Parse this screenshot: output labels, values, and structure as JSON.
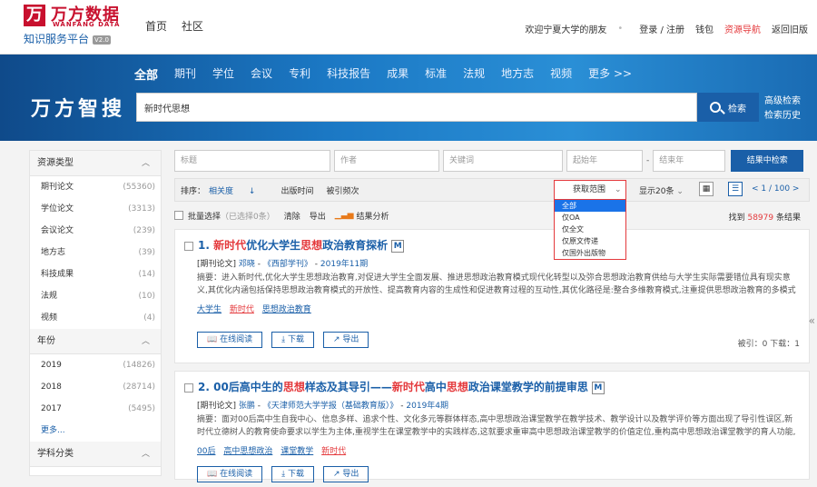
{
  "header": {
    "logo_cn": "万方数据",
    "logo_en": "WANFANG DATA",
    "subtitle": "知识服务平台",
    "version": "V2.0",
    "nav": [
      "首页",
      "社区"
    ],
    "welcome": "欢迎宁夏大学的朋友",
    "login": "登录 / 注册",
    "wallet": "钱包",
    "resource_nav": "资源导航",
    "old_version": "返回旧版"
  },
  "hero": {
    "brand": "万方智搜",
    "tabs": [
      "全部",
      "期刊",
      "学位",
      "会议",
      "专利",
      "科技报告",
      "成果",
      "标准",
      "法规",
      "地方志",
      "视频",
      "更多 >>"
    ],
    "search_value": "新时代思想",
    "search_button": "检索",
    "advanced": "高级检索",
    "history": "检索历史"
  },
  "sidebar": {
    "resource_type_title": "资源类型",
    "resource_types": [
      {
        "label": "期刊论文",
        "count": "(55360)"
      },
      {
        "label": "学位论文",
        "count": "(3313)"
      },
      {
        "label": "会议论文",
        "count": "(239)"
      },
      {
        "label": "地方志",
        "count": "(39)"
      },
      {
        "label": "科技成果",
        "count": "(14)"
      },
      {
        "label": "法规",
        "count": "(10)"
      },
      {
        "label": "视频",
        "count": "(4)"
      }
    ],
    "year_title": "年份",
    "years": [
      {
        "label": "2019",
        "count": "(14826)"
      },
      {
        "label": "2018",
        "count": "(28714)"
      },
      {
        "label": "2017",
        "count": "(5495)"
      }
    ],
    "more": "更多...",
    "subject_title": "学科分类"
  },
  "filters": {
    "title_ph": "标题",
    "author_ph": "作者",
    "keyword_ph": "关键词",
    "start_year_ph": "起始年",
    "sep": "-",
    "end_year_ph": "结束年",
    "search_in_results": "结果中检索"
  },
  "sortbar": {
    "sort_label": "排序：",
    "relevance": "相关度",
    "pub_time": "出版时间",
    "cited": "被引频次",
    "scope": "获取范围",
    "per_page": "显示20条",
    "pager": "< 1 / 100 >"
  },
  "scope_options": [
    "全部",
    "仅OA",
    "仅全文",
    "仅原文传递",
    "仅国外出版物"
  ],
  "batchbar": {
    "batch_select": "批量选择",
    "selected": "（已选择0条）",
    "clear": "清除",
    "export": "导出",
    "analysis": "结果分析",
    "found_prefix": "找到",
    "found_count": "58979",
    "found_suffix": "条结果"
  },
  "results": [
    {
      "num": "1.",
      "title_hl1": "新时代",
      "title_mid": "优化大学生",
      "title_hl2": "思想",
      "title_end": "政治教育探析",
      "badge": "M",
      "type": "[期刊论文]",
      "author": "邓晓",
      "journal": "《西部学刊》",
      "date": "2019年11期",
      "abstract": "摘要：进入新时代,优化大学生思想政治教育,对促进大学生全面发展、推进思想政治教育模式现代化转型以及弥合思想政治教育供给与大学生实际需要错位具有现实意义,其优化内涵包括保持思想政治教育模式的开放性、提高教育内容的生成性和促进教育过程的互动性,其优化路径是:整合多维教育模式,注重提供思想政治教育的多模式方案;运用全...",
      "tags": [
        "大学生",
        "新时代",
        "思想政治教育"
      ],
      "read": "在线阅读",
      "download": "下载",
      "export": "导出",
      "stats": "被引：0    下载：1"
    },
    {
      "num": "2.",
      "title_a": "00后高中生的",
      "title_hl1": "思想",
      "title_b": "样态及其导引——",
      "title_hl2": "新时代",
      "title_c": "高中",
      "title_hl3": "思想",
      "title_d": "政治课堂教学的前提审思",
      "badge": "M",
      "type": "[期刊论文]",
      "author": "张鹏",
      "journal": "《天津师范大学学报（基础教育版）》",
      "date": "2019年4期",
      "abstract": "摘要：面对00后高中生自我中心、信息多样、追求个性、文化多元等群体样态,高中思想政治课堂教学在教学技术、教学设计以及教学评价等方面出现了导引性误区,新时代立德树人的教育使命要求以学生为主体,重视学生在课堂教学中的实践样态,这就要求重审高中思想政治课堂教学的价值定位,重构高中思想政治课堂教学的育人功能,着力培养具...",
      "tags": [
        "00后",
        "高中思想政治",
        "课堂教学",
        "新时代"
      ],
      "read": "在线阅读",
      "download": "下载",
      "export": "导出"
    }
  ],
  "colors": {
    "brand_red": "#c8102e",
    "blue": "#1a5fa8",
    "highlight": "#e4393c"
  }
}
